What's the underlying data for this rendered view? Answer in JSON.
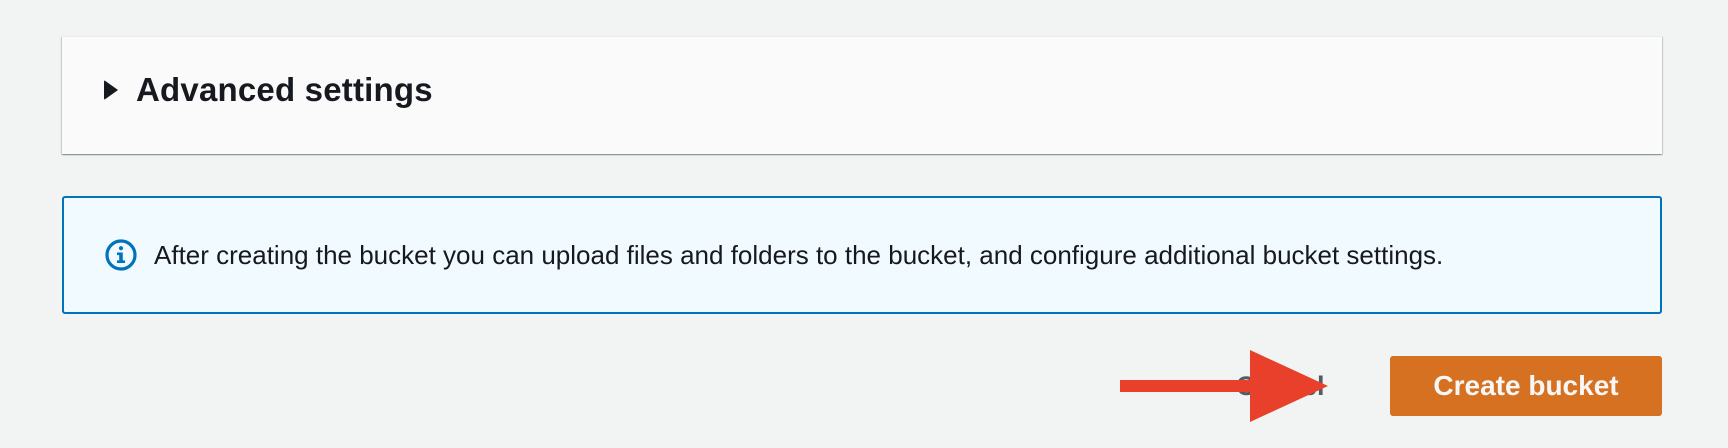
{
  "advanced_settings": {
    "title": "Advanced settings",
    "icon": "caret-right-icon",
    "expanded": false
  },
  "info_alert": {
    "icon": "info-icon",
    "message": "After creating the bucket you can upload files and folders to the bucket, and configure additional bucket settings."
  },
  "footer": {
    "cancel_label": "Cancel",
    "create_label": "Create bucket"
  },
  "annotation": {
    "type": "arrow",
    "color": "#e8402b",
    "points_to": "cancel-button"
  },
  "colors": {
    "page_background": "#f2f3f3",
    "primary_button": "#ec7211",
    "info_border": "#0073bb",
    "info_background": "#f1faff"
  }
}
